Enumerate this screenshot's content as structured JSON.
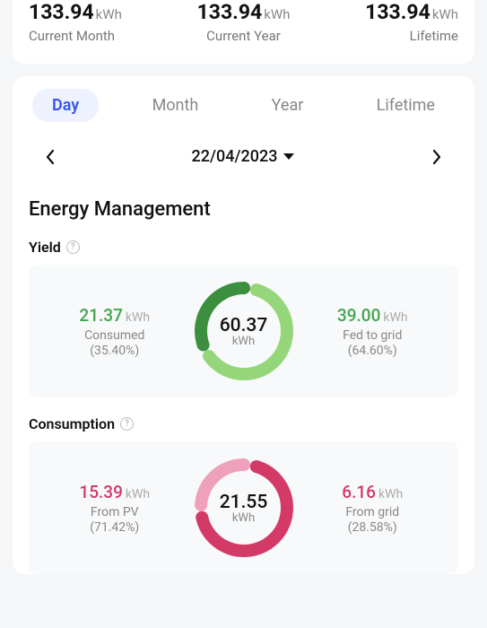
{
  "summary": [
    {
      "value": "133.94",
      "unit": "kWh",
      "label": "Current Month"
    },
    {
      "value": "133.94",
      "unit": "kWh",
      "label": "Current Year"
    },
    {
      "value": "133.94",
      "unit": "kWh",
      "label": "Lifetime"
    }
  ],
  "tabs": [
    "Day",
    "Month",
    "Year",
    "Lifetime"
  ],
  "date": "22/04/2023",
  "section_title": "Energy Management",
  "yield": {
    "title": "Yield",
    "left": {
      "value": "21.37",
      "unit": "kWh",
      "label": "Consumed",
      "pct": "(35.40%)"
    },
    "center": {
      "value": "60.37",
      "unit": "kWh"
    },
    "right": {
      "value": "39.00",
      "unit": "kWh",
      "label": "Fed to grid",
      "pct": "(64.60%)"
    }
  },
  "consumption": {
    "title": "Consumption",
    "left": {
      "value": "15.39",
      "unit": "kWh",
      "label": "From PV",
      "pct": "(71.42%)"
    },
    "center": {
      "value": "21.55",
      "unit": "kWh"
    },
    "right": {
      "value": "6.16",
      "unit": "kWh",
      "label": "From grid",
      "pct": "(28.58%)"
    }
  },
  "chart_data": [
    {
      "type": "pie",
      "title": "Yield",
      "unit": "kWh",
      "total": 60.37,
      "series": [
        {
          "name": "Consumed",
          "value": 21.37,
          "pct": 35.4
        },
        {
          "name": "Fed to grid",
          "value": 39.0,
          "pct": 64.6
        }
      ]
    },
    {
      "type": "pie",
      "title": "Consumption",
      "unit": "kWh",
      "total": 21.55,
      "series": [
        {
          "name": "From PV",
          "value": 15.39,
          "pct": 71.42
        },
        {
          "name": "From grid",
          "value": 6.16,
          "pct": 28.58
        }
      ]
    }
  ]
}
